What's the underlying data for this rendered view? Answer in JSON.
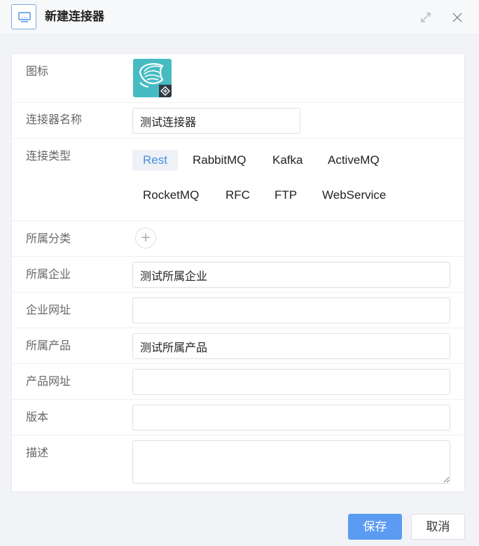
{
  "dialog": {
    "title": "新建连接器",
    "title_icon": "monitor-icon",
    "maximize_icon": "expand-arrows-icon",
    "close_icon": "close-icon"
  },
  "form": {
    "icon_label": "图标",
    "logo_icon": "shell-logo-icon",
    "name_label": "连接器名称",
    "name_value": "测试连接器",
    "type_label": "连接类型",
    "types": [
      "Rest",
      "RabbitMQ",
      "Kafka",
      "ActiveMQ",
      "RocketMQ",
      "RFC",
      "FTP",
      "WebService"
    ],
    "selected_type": "Rest",
    "category_label": "所属分类",
    "category_add_symbol": "+",
    "company_label": "所属企业",
    "company_value": "测试所属企业",
    "company_url_label": "企业网址",
    "company_url_value": "",
    "product_label": "所属产品",
    "product_value": "测试所属产品",
    "product_url_label": "产品网址",
    "product_url_value": "",
    "version_label": "版本",
    "version_value": "",
    "description_label": "描述",
    "description_value": ""
  },
  "footer": {
    "save_label": "保存",
    "cancel_label": "取消"
  },
  "colors": {
    "primary": "#5b9cf2",
    "logo_bg": "#46bcc2",
    "active_chip_text": "#4a90e2"
  }
}
